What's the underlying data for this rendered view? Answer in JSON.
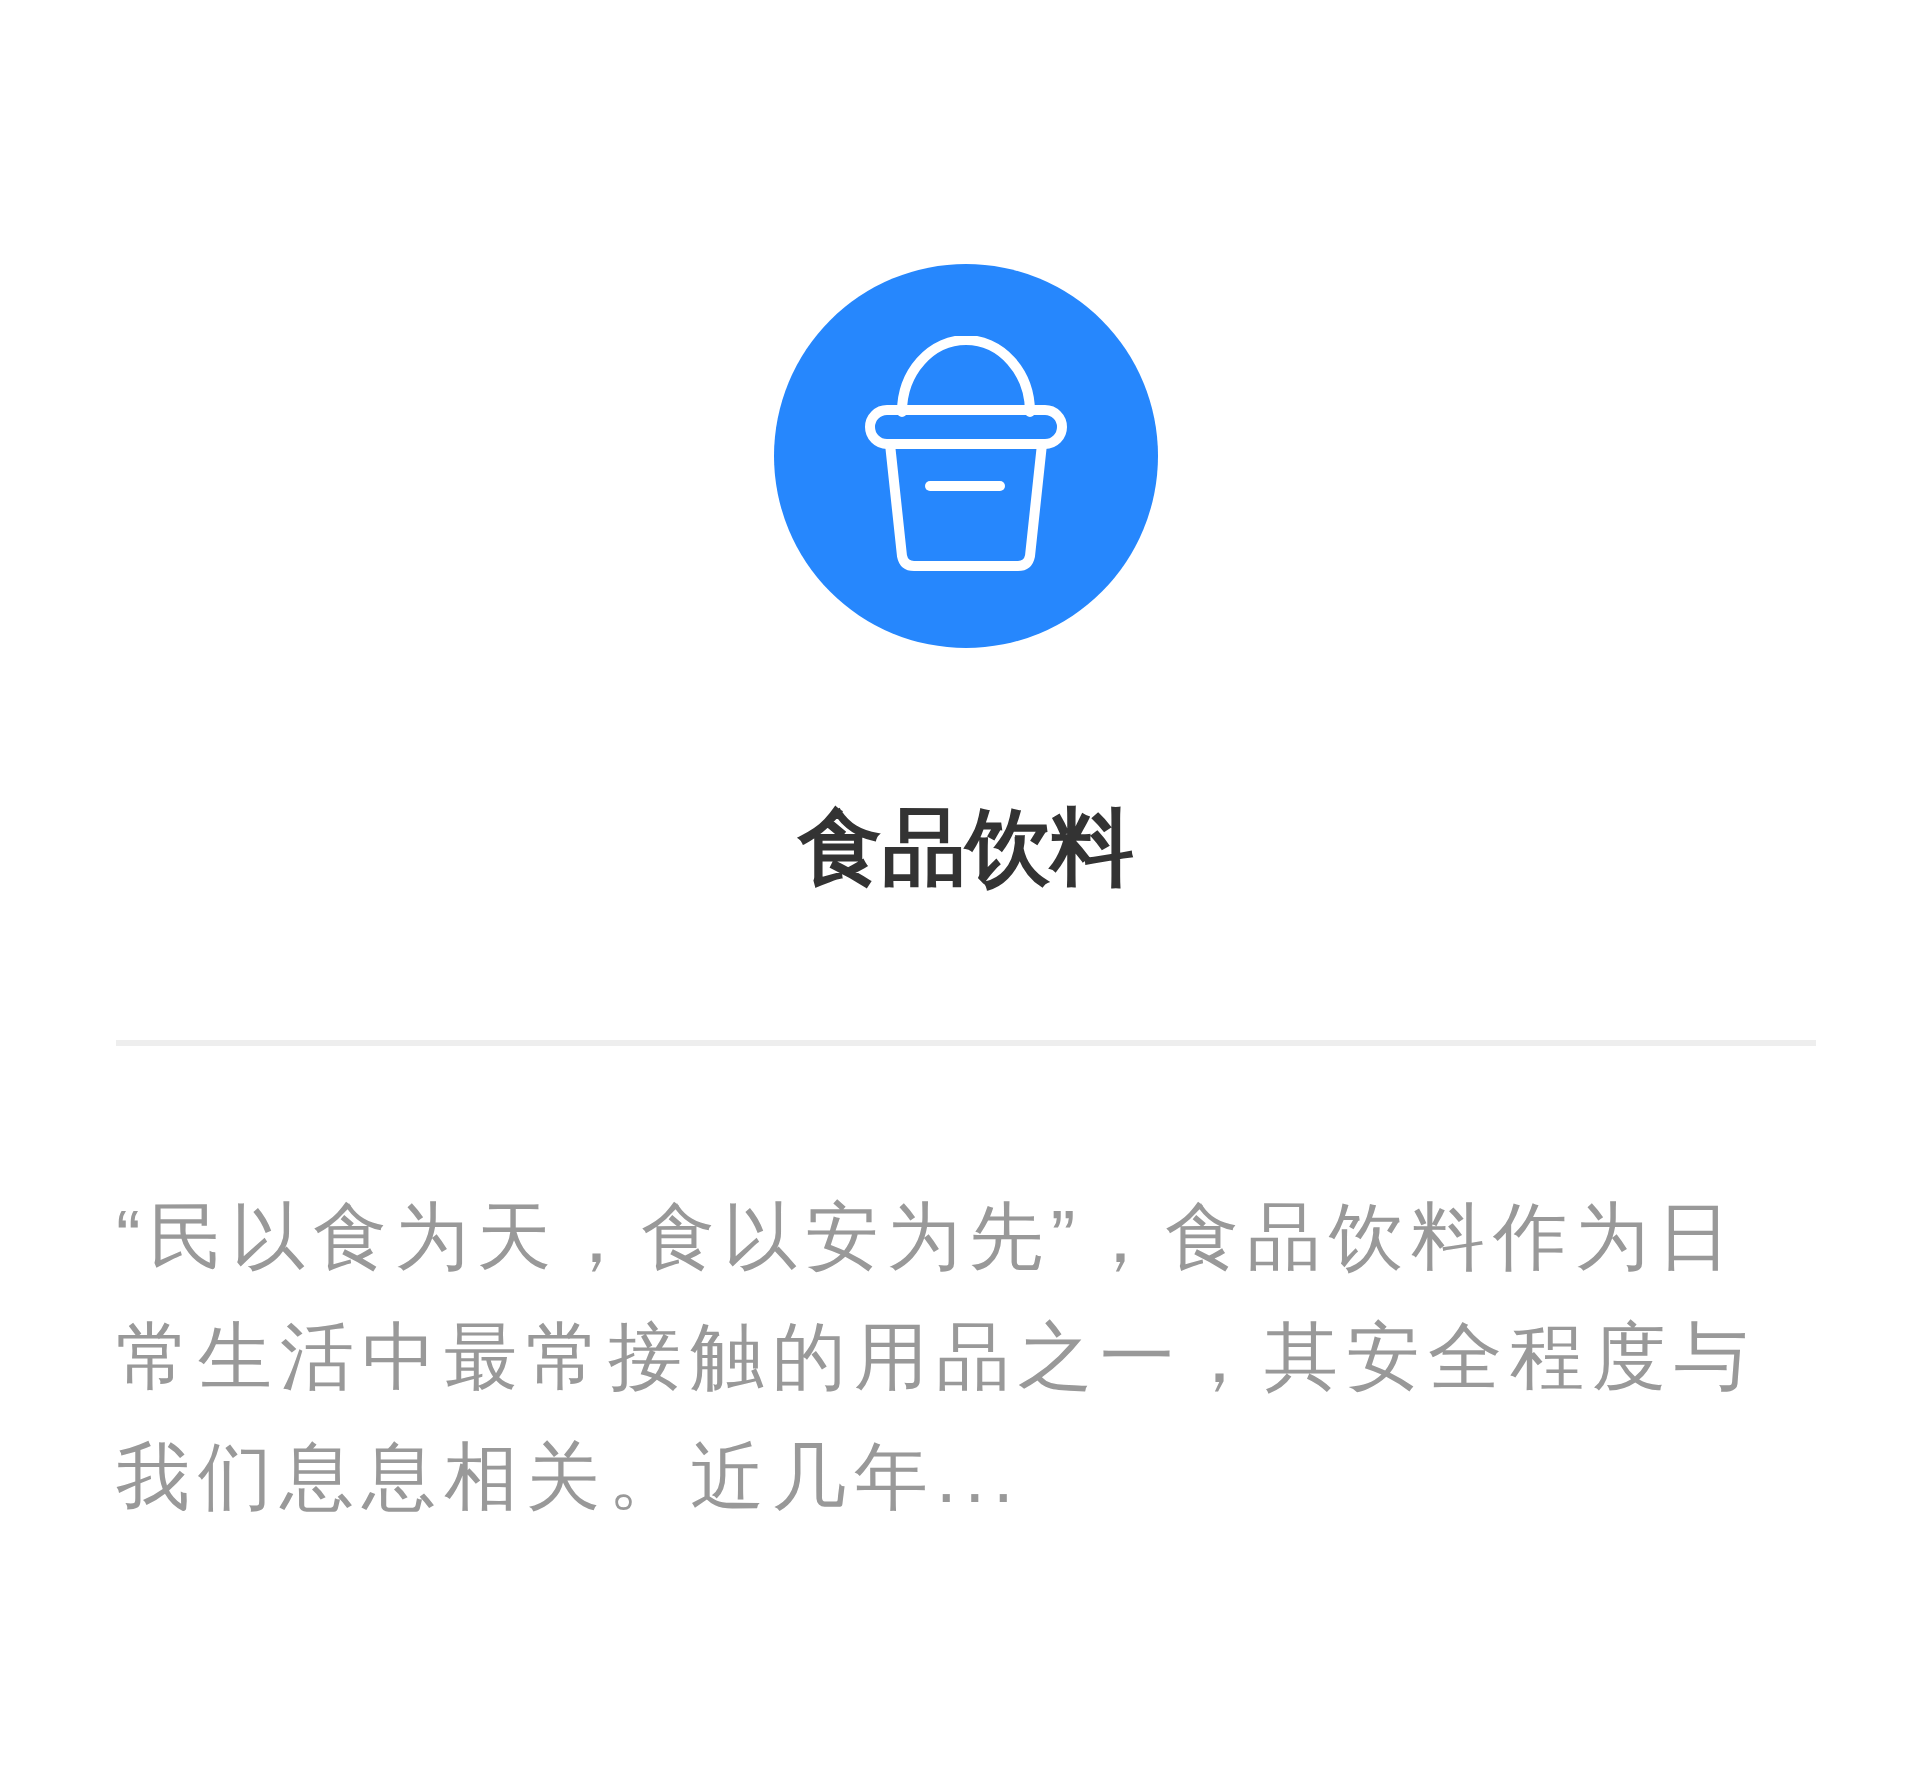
{
  "category": {
    "title": "食品饮料",
    "description": "“民以食为天，食以安为先”，食品饮料作为日常生活中最常接触的用品之一，其安全程度与我们息息相关。近几年..."
  }
}
